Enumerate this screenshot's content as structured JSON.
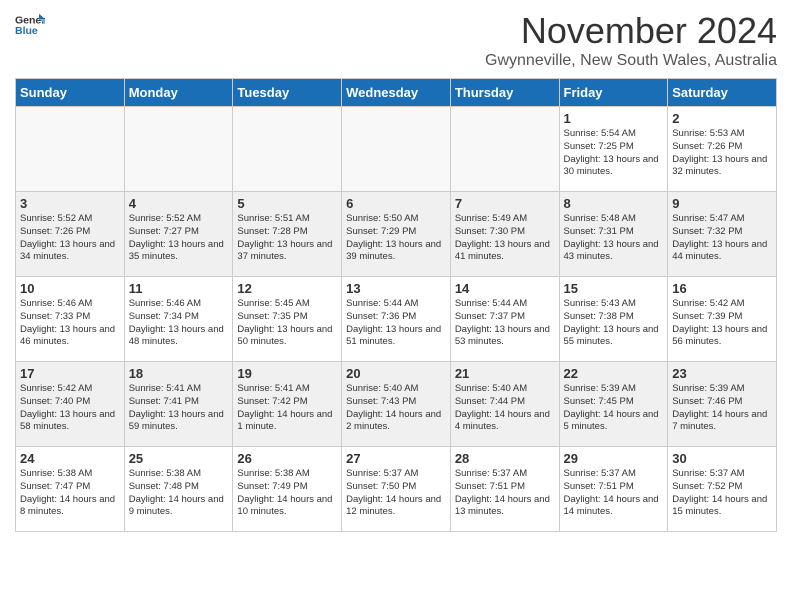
{
  "logo": {
    "general": "General",
    "blue": "Blue"
  },
  "header": {
    "month": "November 2024",
    "location": "Gwynneville, New South Wales, Australia"
  },
  "weekdays": [
    "Sunday",
    "Monday",
    "Tuesday",
    "Wednesday",
    "Thursday",
    "Friday",
    "Saturday"
  ],
  "weeks": [
    [
      {
        "day": "",
        "empty": true
      },
      {
        "day": "",
        "empty": true
      },
      {
        "day": "",
        "empty": true
      },
      {
        "day": "",
        "empty": true
      },
      {
        "day": "",
        "empty": true
      },
      {
        "day": "1",
        "sunrise": "Sunrise: 5:54 AM",
        "sunset": "Sunset: 7:25 PM",
        "daylight": "Daylight: 13 hours and 30 minutes."
      },
      {
        "day": "2",
        "sunrise": "Sunrise: 5:53 AM",
        "sunset": "Sunset: 7:26 PM",
        "daylight": "Daylight: 13 hours and 32 minutes."
      }
    ],
    [
      {
        "day": "3",
        "sunrise": "Sunrise: 5:52 AM",
        "sunset": "Sunset: 7:26 PM",
        "daylight": "Daylight: 13 hours and 34 minutes."
      },
      {
        "day": "4",
        "sunrise": "Sunrise: 5:52 AM",
        "sunset": "Sunset: 7:27 PM",
        "daylight": "Daylight: 13 hours and 35 minutes."
      },
      {
        "day": "5",
        "sunrise": "Sunrise: 5:51 AM",
        "sunset": "Sunset: 7:28 PM",
        "daylight": "Daylight: 13 hours and 37 minutes."
      },
      {
        "day": "6",
        "sunrise": "Sunrise: 5:50 AM",
        "sunset": "Sunset: 7:29 PM",
        "daylight": "Daylight: 13 hours and 39 minutes."
      },
      {
        "day": "7",
        "sunrise": "Sunrise: 5:49 AM",
        "sunset": "Sunset: 7:30 PM",
        "daylight": "Daylight: 13 hours and 41 minutes."
      },
      {
        "day": "8",
        "sunrise": "Sunrise: 5:48 AM",
        "sunset": "Sunset: 7:31 PM",
        "daylight": "Daylight: 13 hours and 43 minutes."
      },
      {
        "day": "9",
        "sunrise": "Sunrise: 5:47 AM",
        "sunset": "Sunset: 7:32 PM",
        "daylight": "Daylight: 13 hours and 44 minutes."
      }
    ],
    [
      {
        "day": "10",
        "sunrise": "Sunrise: 5:46 AM",
        "sunset": "Sunset: 7:33 PM",
        "daylight": "Daylight: 13 hours and 46 minutes."
      },
      {
        "day": "11",
        "sunrise": "Sunrise: 5:46 AM",
        "sunset": "Sunset: 7:34 PM",
        "daylight": "Daylight: 13 hours and 48 minutes."
      },
      {
        "day": "12",
        "sunrise": "Sunrise: 5:45 AM",
        "sunset": "Sunset: 7:35 PM",
        "daylight": "Daylight: 13 hours and 50 minutes."
      },
      {
        "day": "13",
        "sunrise": "Sunrise: 5:44 AM",
        "sunset": "Sunset: 7:36 PM",
        "daylight": "Daylight: 13 hours and 51 minutes."
      },
      {
        "day": "14",
        "sunrise": "Sunrise: 5:44 AM",
        "sunset": "Sunset: 7:37 PM",
        "daylight": "Daylight: 13 hours and 53 minutes."
      },
      {
        "day": "15",
        "sunrise": "Sunrise: 5:43 AM",
        "sunset": "Sunset: 7:38 PM",
        "daylight": "Daylight: 13 hours and 55 minutes."
      },
      {
        "day": "16",
        "sunrise": "Sunrise: 5:42 AM",
        "sunset": "Sunset: 7:39 PM",
        "daylight": "Daylight: 13 hours and 56 minutes."
      }
    ],
    [
      {
        "day": "17",
        "sunrise": "Sunrise: 5:42 AM",
        "sunset": "Sunset: 7:40 PM",
        "daylight": "Daylight: 13 hours and 58 minutes."
      },
      {
        "day": "18",
        "sunrise": "Sunrise: 5:41 AM",
        "sunset": "Sunset: 7:41 PM",
        "daylight": "Daylight: 13 hours and 59 minutes."
      },
      {
        "day": "19",
        "sunrise": "Sunrise: 5:41 AM",
        "sunset": "Sunset: 7:42 PM",
        "daylight": "Daylight: 14 hours and 1 minute."
      },
      {
        "day": "20",
        "sunrise": "Sunrise: 5:40 AM",
        "sunset": "Sunset: 7:43 PM",
        "daylight": "Daylight: 14 hours and 2 minutes."
      },
      {
        "day": "21",
        "sunrise": "Sunrise: 5:40 AM",
        "sunset": "Sunset: 7:44 PM",
        "daylight": "Daylight: 14 hours and 4 minutes."
      },
      {
        "day": "22",
        "sunrise": "Sunrise: 5:39 AM",
        "sunset": "Sunset: 7:45 PM",
        "daylight": "Daylight: 14 hours and 5 minutes."
      },
      {
        "day": "23",
        "sunrise": "Sunrise: 5:39 AM",
        "sunset": "Sunset: 7:46 PM",
        "daylight": "Daylight: 14 hours and 7 minutes."
      }
    ],
    [
      {
        "day": "24",
        "sunrise": "Sunrise: 5:38 AM",
        "sunset": "Sunset: 7:47 PM",
        "daylight": "Daylight: 14 hours and 8 minutes."
      },
      {
        "day": "25",
        "sunrise": "Sunrise: 5:38 AM",
        "sunset": "Sunset: 7:48 PM",
        "daylight": "Daylight: 14 hours and 9 minutes."
      },
      {
        "day": "26",
        "sunrise": "Sunrise: 5:38 AM",
        "sunset": "Sunset: 7:49 PM",
        "daylight": "Daylight: 14 hours and 10 minutes."
      },
      {
        "day": "27",
        "sunrise": "Sunrise: 5:37 AM",
        "sunset": "Sunset: 7:50 PM",
        "daylight": "Daylight: 14 hours and 12 minutes."
      },
      {
        "day": "28",
        "sunrise": "Sunrise: 5:37 AM",
        "sunset": "Sunset: 7:51 PM",
        "daylight": "Daylight: 14 hours and 13 minutes."
      },
      {
        "day": "29",
        "sunrise": "Sunrise: 5:37 AM",
        "sunset": "Sunset: 7:51 PM",
        "daylight": "Daylight: 14 hours and 14 minutes."
      },
      {
        "day": "30",
        "sunrise": "Sunrise: 5:37 AM",
        "sunset": "Sunset: 7:52 PM",
        "daylight": "Daylight: 14 hours and 15 minutes."
      }
    ]
  ]
}
